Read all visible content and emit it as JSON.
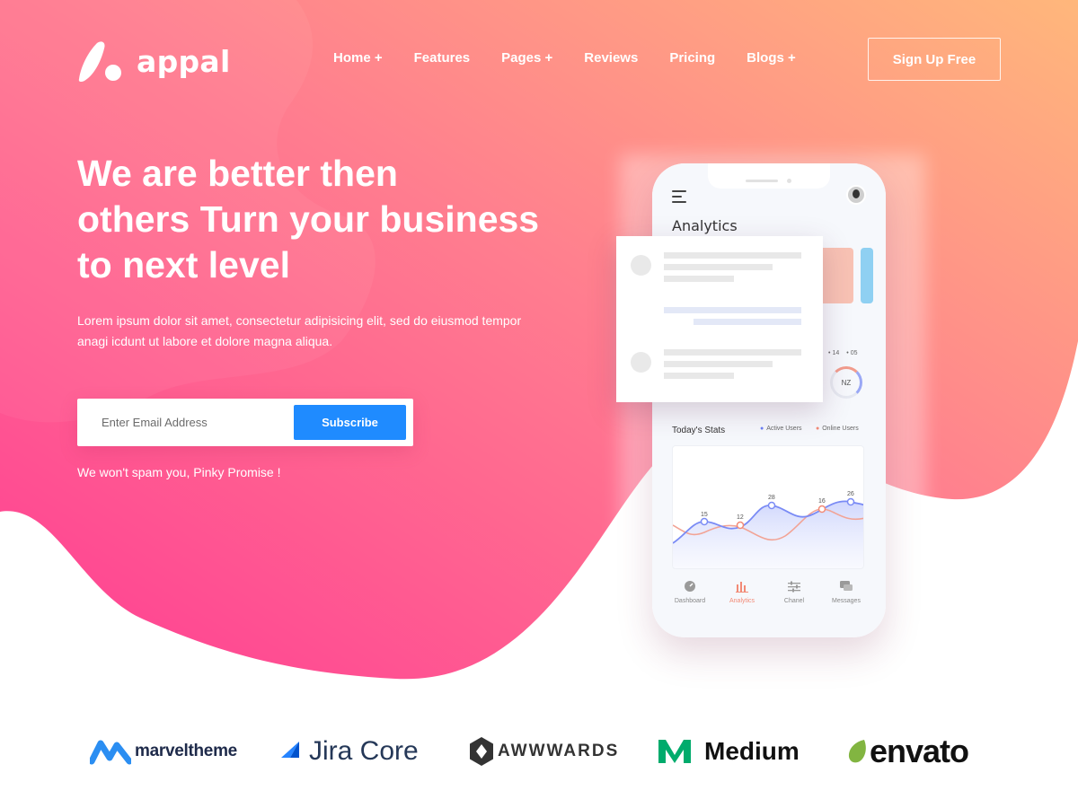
{
  "colors": {
    "gradient_start": "#ff4c97",
    "gradient_end": "#ffb37b",
    "subscribe": "#1f8bff",
    "active_users": "#6b7ff5",
    "online_users": "#f28a76"
  },
  "header": {
    "logo_text": "appal",
    "menu": [
      "Home +",
      "Features",
      "Pages +",
      "Reviews",
      "Pricing",
      "Blogs +"
    ],
    "signup_label": "Sign Up Free"
  },
  "hero": {
    "headline_lines": [
      "We are better then",
      "others Turn your business",
      "to next level"
    ],
    "subtext_lines": [
      "Lorem ipsum dolor sit amet, consectetur adipisicing elit, sed do eiusmod tempor",
      "anagi icdunt ut labore et dolore magna aliqua."
    ],
    "email_placeholder": "Enter Email Address",
    "subscribe_label": "Subscribe",
    "promise": "We won't spam you, Pinky Promise !"
  },
  "phone": {
    "title": "Analytics",
    "legend_values": [
      "14",
      "05"
    ],
    "ring_label": "NZ",
    "stats_title": "Today's Stats",
    "legend_active": "Active Users",
    "legend_online": "Online Users",
    "point_values": [
      "15",
      "12",
      "28",
      "16",
      "26"
    ],
    "tabs": [
      {
        "label": "Dashboard",
        "icon": "gauge-icon"
      },
      {
        "label": "Analytics",
        "icon": "bar-chart-icon"
      },
      {
        "label": "Chanel",
        "icon": "sliders-icon"
      },
      {
        "label": "Messages",
        "icon": "chat-icon"
      }
    ]
  },
  "brands": [
    "marveltheme",
    "Jira Core",
    "AWWWARDS",
    "Medium",
    "envato"
  ]
}
